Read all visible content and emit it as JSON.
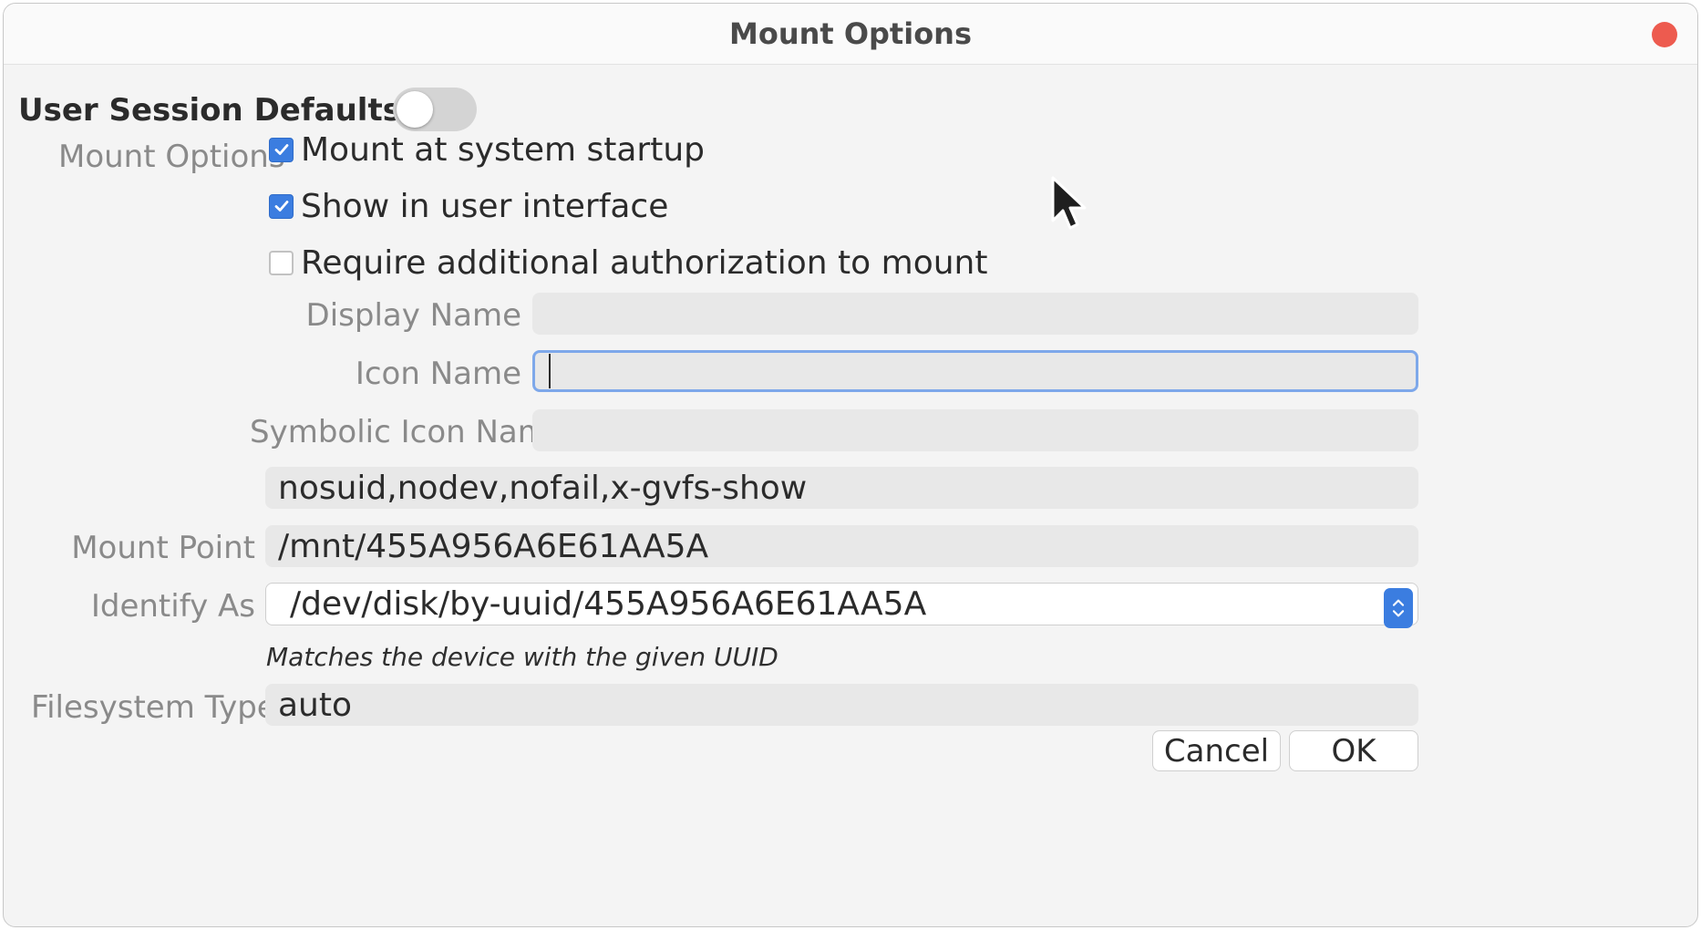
{
  "window": {
    "title": "Mount Options"
  },
  "section": {
    "label": "User Session Defaults",
    "toggle_on": false
  },
  "labels": {
    "mount_options": "Mount Options",
    "display_name": "Display Name",
    "icon_name": "Icon Name",
    "symbolic_icon_name": "Symbolic Icon Name",
    "mount_point": "Mount Point",
    "identify_as": "Identify As",
    "filesystem_type": "Filesystem Type"
  },
  "checkboxes": [
    {
      "label": "Mount at system startup",
      "checked": true
    },
    {
      "label": "Show in user interface",
      "checked": true
    },
    {
      "label": "Require additional authorization to mount",
      "checked": false
    }
  ],
  "fields": {
    "display_name": "",
    "icon_name": "",
    "symbolic_icon_name": "",
    "options_string": "nosuid,nodev,nofail,x-gvfs-show",
    "mount_point": "/mnt/455A956A6E61AA5A",
    "identify_as": "/dev/disk/by-uuid/455A956A6E61AA5A",
    "identify_hint": "Matches the device with the given UUID",
    "filesystem_type": "auto"
  },
  "buttons": {
    "cancel": "Cancel",
    "ok": "OK"
  },
  "colors": {
    "accent": "#3b7de0",
    "close": "#ed5b4f",
    "focus_ring": "#7ea8ea"
  },
  "icons": [
    "close-icon",
    "check-icon",
    "spinner-arrows-icon",
    "mouse-pointer-icon"
  ]
}
